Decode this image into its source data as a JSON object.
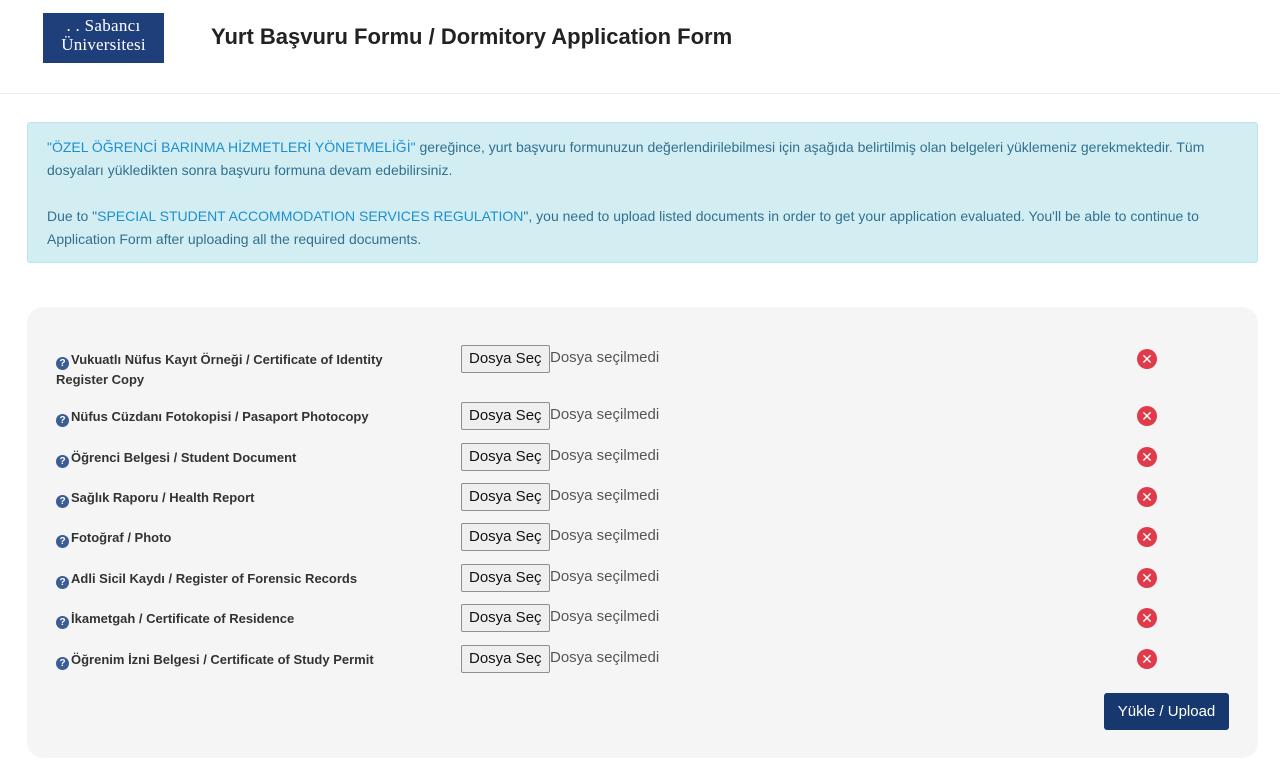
{
  "header": {
    "logo_line1": ". . Sabancı",
    "logo_line2": "Üniversitesi",
    "title": "Yurt Başvuru Formu / Dormitory Application Form"
  },
  "notice": {
    "tr_highlight": "\"ÖZEL ÖĞRENCİ BARINMA HİZMETLERİ YÖNETMELİĞİ\"",
    "tr_text": " gereğince, yurt başvuru formunuzun değerlendirilebilmesi için aşağıda belirtilmiş olan belgeleri yüklemeniz gerekmektedir. Tüm dosyaları yükledikten sonra başvuru formuna devam edebilirsiniz.",
    "en_prefix": "Due to \"",
    "en_highlight": "SPECIAL STUDENT ACCOMMODATION SERVICES REGULATION",
    "en_text": "\", you need to upload listed documents in order to get your application evaluated. You'll be able to continue to Application Form after uploading all the required documents."
  },
  "documents": [
    {
      "label": "Vukuatlı Nüfus Kayıt Örneği / Certificate of Identity Register Copy",
      "button": "Dosya Seç",
      "status": "Dosya seçilmedi"
    },
    {
      "label": "Nüfus Cüzdanı Fotokopisi / Pasaport Photocopy",
      "button": "Dosya Seç",
      "status": "Dosya seçilmedi"
    },
    {
      "label": "Öğrenci Belgesi / Student Document",
      "button": "Dosya Seç",
      "status": "Dosya seçilmedi"
    },
    {
      "label": "Sağlık Raporu / Health Report",
      "button": "Dosya Seç",
      "status": "Dosya seçilmedi"
    },
    {
      "label": "Fotoğraf / Photo",
      "button": "Dosya Seç",
      "status": "Dosya seçilmedi"
    },
    {
      "label": "Adli Sicil Kaydı / Register of Forensic Records",
      "button": "Dosya Seç",
      "status": "Dosya seçilmedi"
    },
    {
      "label": "İkametgah / Certificate of Residence",
      "button": "Dosya Seç",
      "status": "Dosya seçilmedi"
    },
    {
      "label": "Öğrenim İzni Belgesi / Certificate of Study Permit",
      "button": "Dosya Seç",
      "status": "Dosya seçilmedi"
    }
  ],
  "icons": {
    "help": "question-circle-icon",
    "remove": "remove-circle-icon"
  },
  "colors": {
    "brand": "#1f3f7a",
    "button": "#17386e",
    "notice_bg": "#d3eef3",
    "remove": "#e03b4a"
  },
  "upload_label": "Yükle / Upload"
}
